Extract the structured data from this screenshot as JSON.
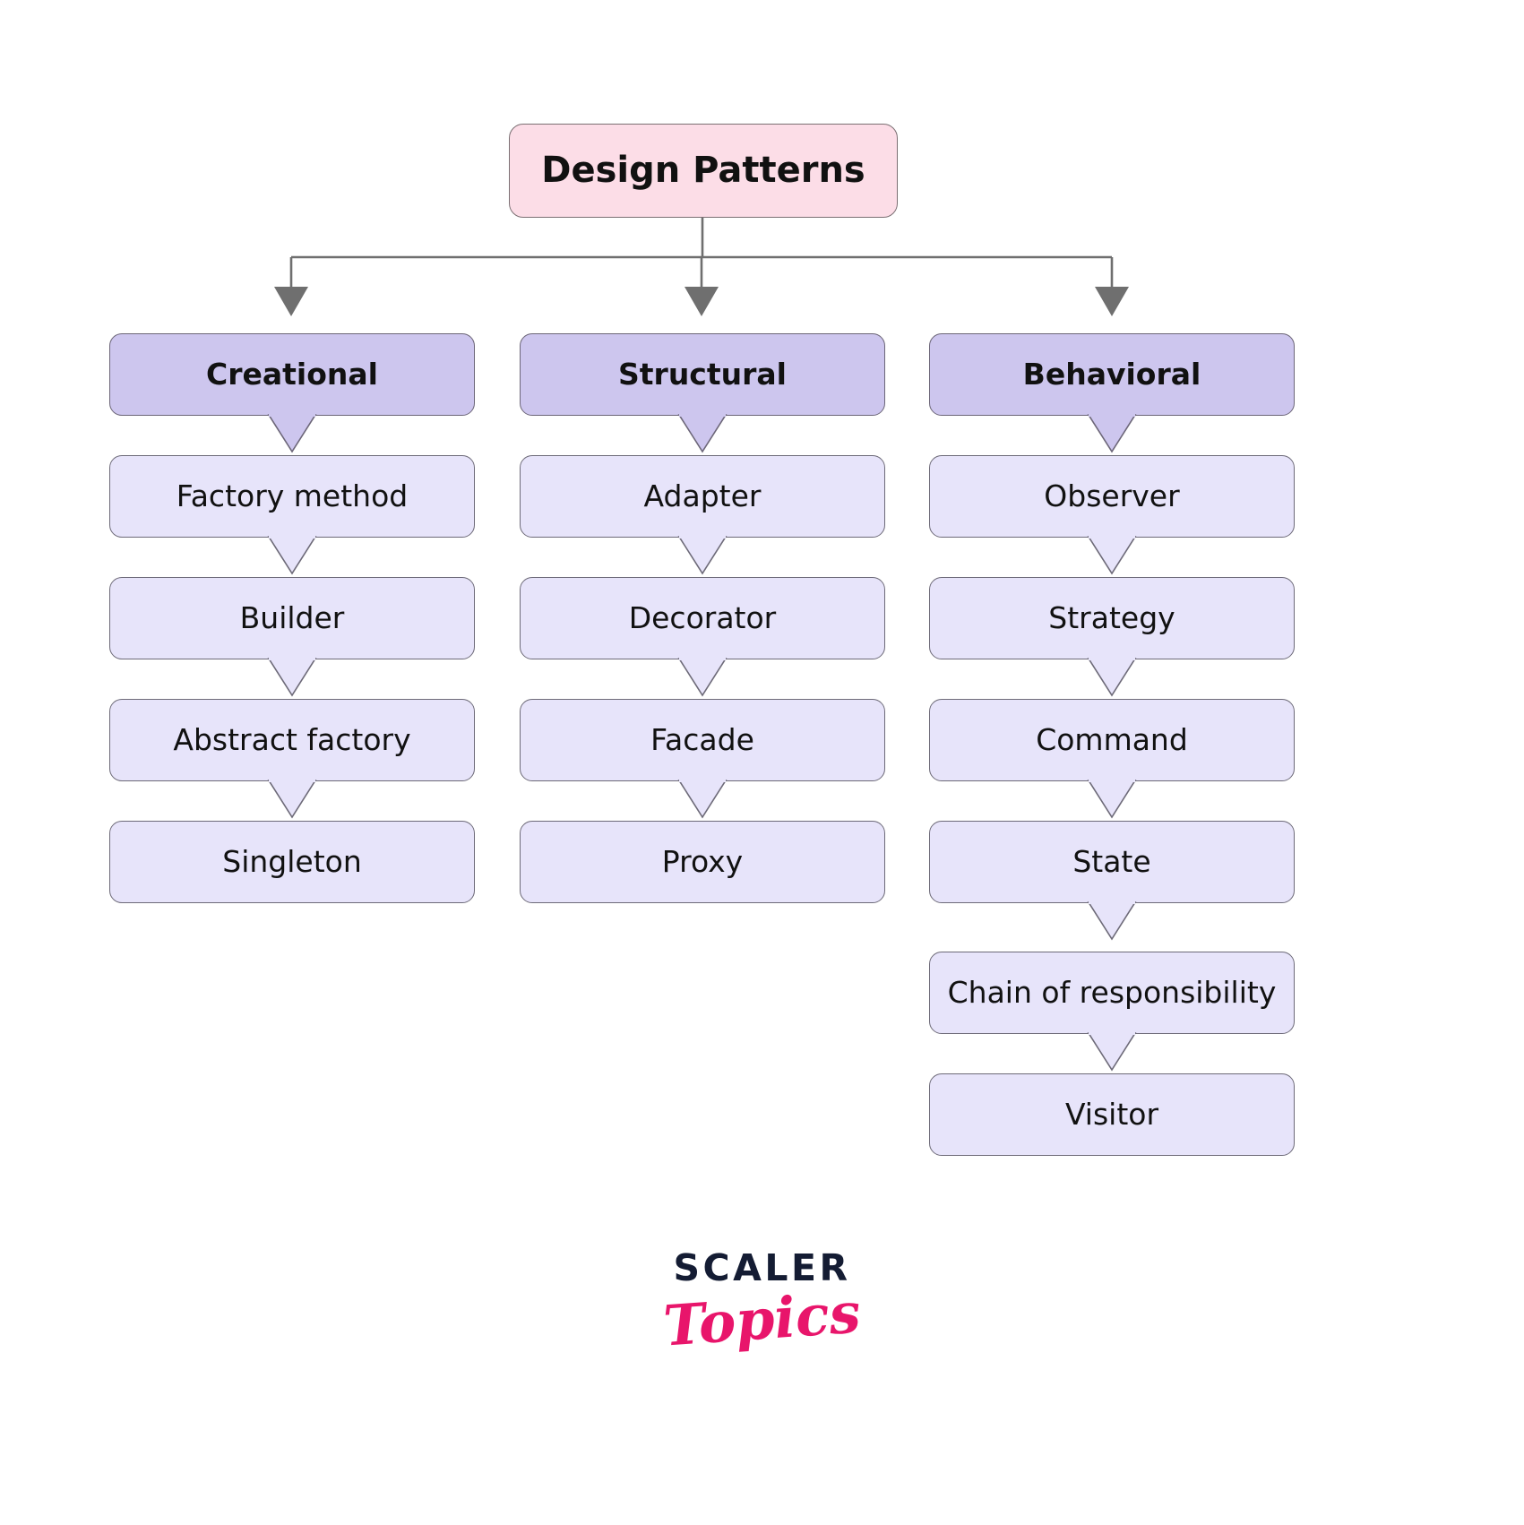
{
  "diagram": {
    "title": "Design Patterns",
    "root": {
      "label": "Design Patterns",
      "fill": "#fcdde7",
      "stroke": "#7b6f73"
    },
    "connector": {
      "color": "#6f6f6f",
      "arrow": "down-arrow-icon",
      "style": "orthogonal"
    },
    "category_style": {
      "fill": "#cdc6ee",
      "stroke": "#6c6678"
    },
    "leaf_style": {
      "fill": "#e7e4fa",
      "stroke": "#6d6a78"
    },
    "columns": [
      {
        "category": "Creational",
        "items": [
          {
            "label": "Factory method"
          },
          {
            "label": "Builder"
          },
          {
            "label": "Abstract factory"
          },
          {
            "label": "Singleton"
          }
        ]
      },
      {
        "category": "Structural",
        "items": [
          {
            "label": "Adapter"
          },
          {
            "label": "Decorator"
          },
          {
            "label": "Facade"
          },
          {
            "label": "Proxy"
          }
        ]
      },
      {
        "category": "Behavioral",
        "items": [
          {
            "label": "Observer"
          },
          {
            "label": "Strategy"
          },
          {
            "label": "Command"
          },
          {
            "label": "State"
          },
          {
            "label": "Chain of responsibility"
          },
          {
            "label": "Visitor"
          }
        ]
      }
    ]
  },
  "logo": {
    "primary": "SCALER",
    "secondary": "Topics",
    "primary_color": "#141c33",
    "secondary_color": "#e8156b"
  }
}
